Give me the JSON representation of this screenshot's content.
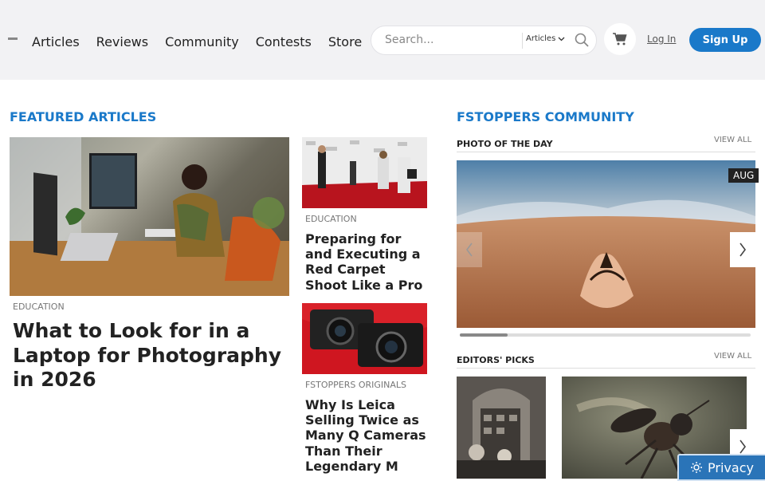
{
  "nav": {
    "items": [
      "Articles",
      "Reviews",
      "Community",
      "Contests",
      "Store"
    ]
  },
  "search": {
    "placeholder": "Search...",
    "scope": "Articles"
  },
  "auth": {
    "login": "Log In",
    "signup": "Sign Up"
  },
  "featured": {
    "title": "FEATURED ARTICLES",
    "main": {
      "category": "EDUCATION",
      "headline": "What to Look for in a Laptop for Photography in 2026"
    },
    "side": [
      {
        "category": "EDUCATION",
        "headline": "Preparing for and Executing a Red Carpet Shoot Like a Pro"
      },
      {
        "category": "FSTOPPERS ORIGINALS",
        "headline": "Why Is Leica Selling Twice as Many Q Cameras Than Their Legendary M"
      }
    ]
  },
  "community": {
    "title": "FSTOPPERS COMMUNITY",
    "potd": {
      "title": "PHOTO OF THE DAY",
      "view_all": "VIEW ALL",
      "date": "AUG"
    },
    "editors": {
      "title": "EDITORS' PICKS",
      "view_all": "VIEW ALL"
    }
  },
  "privacy": {
    "label": "Privacy"
  }
}
